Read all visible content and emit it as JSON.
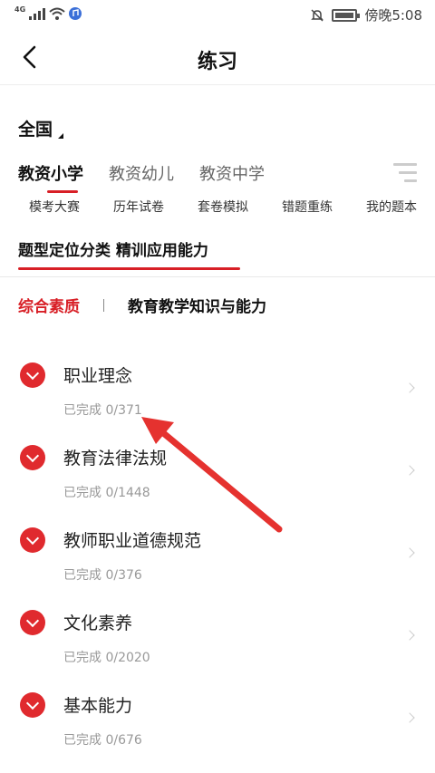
{
  "status_bar": {
    "network": "4G",
    "time_label": "傍晚5:08"
  },
  "header": {
    "title": "练习"
  },
  "region": {
    "label": "全国"
  },
  "tabs": [
    {
      "label": "教资小学",
      "active": true
    },
    {
      "label": "教资幼儿",
      "active": false
    },
    {
      "label": "教资中学",
      "active": false
    }
  ],
  "subnav": [
    "模考大赛",
    "历年试卷",
    "套卷模拟",
    "错题重练",
    "我的题本"
  ],
  "section": {
    "title": "题型定位分类 精训应用能力"
  },
  "categories": [
    {
      "label": "综合素质",
      "active": true
    },
    {
      "label": "教育教学知识与能力",
      "active": false
    }
  ],
  "items": [
    {
      "name": "职业理念",
      "progress": "已完成 0/371"
    },
    {
      "name": "教育法律法规",
      "progress": "已完成 0/1448"
    },
    {
      "name": "教师职业道德规范",
      "progress": "已完成 0/376"
    },
    {
      "name": "文化素养",
      "progress": "已完成 0/2020"
    },
    {
      "name": "基本能力",
      "progress": "已完成 0/676"
    }
  ],
  "colors": {
    "accent": "#d81f26",
    "badge": "#e02a2e"
  }
}
